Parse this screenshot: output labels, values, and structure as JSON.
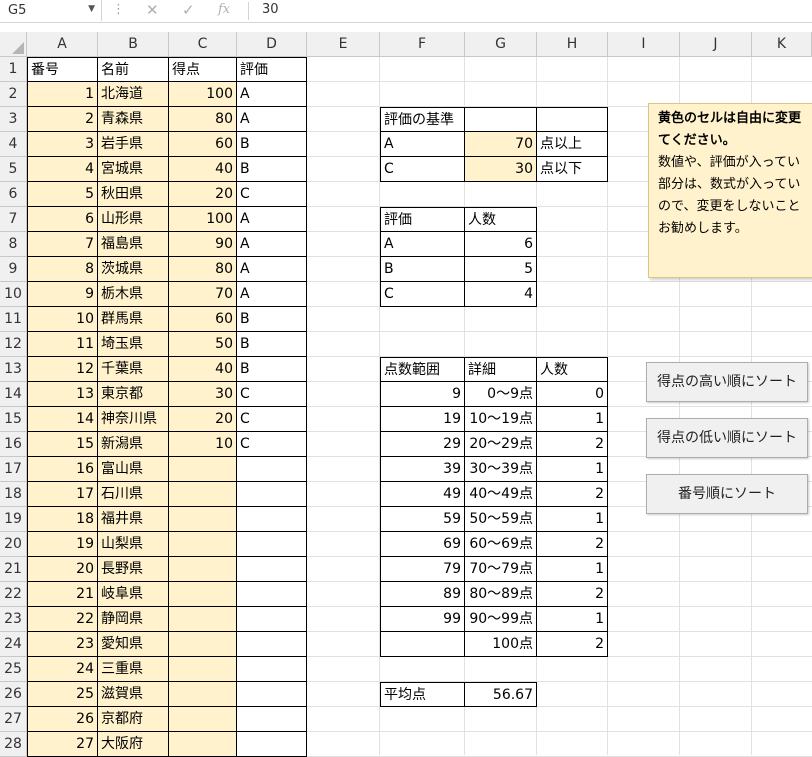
{
  "formula_bar": {
    "name_box": "G5",
    "value": "30"
  },
  "columns": [
    "A",
    "B",
    "C",
    "D",
    "E",
    "F",
    "G",
    "H",
    "I",
    "J",
    "K"
  ],
  "rows": [
    "1",
    "2",
    "3",
    "4",
    "5",
    "6",
    "7",
    "8",
    "9",
    "10",
    "11",
    "12",
    "13",
    "14",
    "15",
    "16",
    "17",
    "18",
    "19",
    "20",
    "21",
    "22",
    "23",
    "24",
    "25",
    "26",
    "27",
    "28"
  ],
  "headers": {
    "a": "番号",
    "b": "名前",
    "c": "得点",
    "d": "評価"
  },
  "table": [
    {
      "no": "1",
      "name": "北海道",
      "score": "100",
      "grade": "A"
    },
    {
      "no": "2",
      "name": "青森県",
      "score": "80",
      "grade": "A"
    },
    {
      "no": "3",
      "name": "岩手県",
      "score": "60",
      "grade": "B"
    },
    {
      "no": "4",
      "name": "宮城県",
      "score": "40",
      "grade": "B"
    },
    {
      "no": "5",
      "name": "秋田県",
      "score": "20",
      "grade": "C"
    },
    {
      "no": "6",
      "name": "山形県",
      "score": "100",
      "grade": "A"
    },
    {
      "no": "7",
      "name": "福島県",
      "score": "90",
      "grade": "A"
    },
    {
      "no": "8",
      "name": "茨城県",
      "score": "80",
      "grade": "A"
    },
    {
      "no": "9",
      "name": "栃木県",
      "score": "70",
      "grade": "A"
    },
    {
      "no": "10",
      "name": "群馬県",
      "score": "60",
      "grade": "B"
    },
    {
      "no": "11",
      "name": "埼玉県",
      "score": "50",
      "grade": "B"
    },
    {
      "no": "12",
      "name": "千葉県",
      "score": "40",
      "grade": "B"
    },
    {
      "no": "13",
      "name": "東京都",
      "score": "30",
      "grade": "C"
    },
    {
      "no": "14",
      "name": "神奈川県",
      "score": "20",
      "grade": "C"
    },
    {
      "no": "15",
      "name": "新潟県",
      "score": "10",
      "grade": "C"
    },
    {
      "no": "16",
      "name": "富山県",
      "score": "",
      "grade": ""
    },
    {
      "no": "17",
      "name": "石川県",
      "score": "",
      "grade": ""
    },
    {
      "no": "18",
      "name": "福井県",
      "score": "",
      "grade": ""
    },
    {
      "no": "19",
      "name": "山梨県",
      "score": "",
      "grade": ""
    },
    {
      "no": "20",
      "name": "長野県",
      "score": "",
      "grade": ""
    },
    {
      "no": "21",
      "name": "岐阜県",
      "score": "",
      "grade": ""
    },
    {
      "no": "22",
      "name": "静岡県",
      "score": "",
      "grade": ""
    },
    {
      "no": "23",
      "name": "愛知県",
      "score": "",
      "grade": ""
    },
    {
      "no": "24",
      "name": "三重県",
      "score": "",
      "grade": ""
    },
    {
      "no": "25",
      "name": "滋賀県",
      "score": "",
      "grade": ""
    },
    {
      "no": "26",
      "name": "京都府",
      "score": "",
      "grade": ""
    },
    {
      "no": "27",
      "name": "大阪府",
      "score": "",
      "grade": ""
    }
  ],
  "criteria": {
    "title": "評価の基準",
    "rows": [
      {
        "grade": "A",
        "value": "70",
        "unit": "点以上"
      },
      {
        "grade": "C",
        "value": "30",
        "unit": "点以下"
      }
    ]
  },
  "grade_counts": {
    "header_grade": "評価",
    "header_count": "人数",
    "rows": [
      {
        "grade": "A",
        "count": "6"
      },
      {
        "grade": "B",
        "count": "5"
      },
      {
        "grade": "C",
        "count": "4"
      }
    ]
  },
  "distribution": {
    "header_range": "点数範囲",
    "header_detail": "詳細",
    "header_count": "人数",
    "rows": [
      {
        "range": "9",
        "detail": "0～9点",
        "count": "0"
      },
      {
        "range": "19",
        "detail": "10～19点",
        "count": "1"
      },
      {
        "range": "29",
        "detail": "20～29点",
        "count": "2"
      },
      {
        "range": "39",
        "detail": "30～39点",
        "count": "1"
      },
      {
        "range": "49",
        "detail": "40～49点",
        "count": "2"
      },
      {
        "range": "59",
        "detail": "50～59点",
        "count": "1"
      },
      {
        "range": "69",
        "detail": "60～69点",
        "count": "2"
      },
      {
        "range": "79",
        "detail": "70～79点",
        "count": "1"
      },
      {
        "range": "89",
        "detail": "80～89点",
        "count": "2"
      },
      {
        "range": "99",
        "detail": "90～99点",
        "count": "1"
      },
      {
        "range": "",
        "detail": "100点",
        "count": "2"
      }
    ]
  },
  "average": {
    "label": "平均点",
    "value": "56.67"
  },
  "note": {
    "line1": "黄色のセルは自由に変更",
    "line2": "てください。",
    "line3": "数値や、評価が入ってい",
    "line4": "部分は、数式が入ってい",
    "line5": "ので、変更をしないこと",
    "line6": "お勧めします。"
  },
  "buttons": {
    "sort_high": "得点の高い順にソート",
    "sort_low": "得点の低い順にソート",
    "sort_number": "番号順にソート"
  },
  "colors": {
    "input_fill": "#fff2cc",
    "header_bg": "#f0f0f0"
  }
}
